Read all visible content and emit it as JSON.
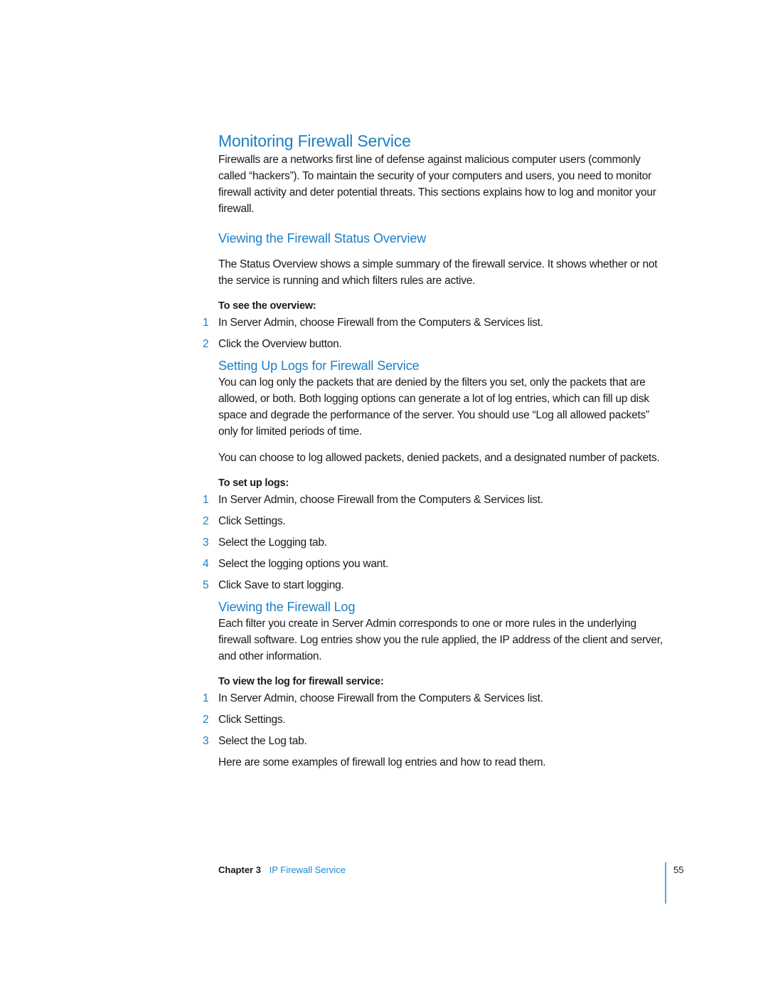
{
  "section": {
    "title": "Monitoring Firewall Service",
    "intro": "Firewalls are a networks first line of defense against malicious computer users (commonly called “hackers”). To maintain the security of your computers and users, you need to monitor firewall activity and deter potential threats. This sections explains how to log and monitor your firewall."
  },
  "subsections": [
    {
      "title": "Viewing the Firewall Status Overview",
      "paragraphs": [
        "The Status Overview shows a simple summary of the firewall service. It shows whether or not the service is running and which filters rules are active."
      ],
      "task_label": "To see the overview:",
      "steps": [
        {
          "num": "1",
          "text": "In Server Admin, choose Firewall from the Computers & Services list."
        },
        {
          "num": "2",
          "text": "Click the Overview button."
        }
      ]
    },
    {
      "title": "Setting Up Logs for Firewall Service",
      "paragraphs": [
        "You can log only the packets that are denied by the filters you set, only the packets that are allowed, or both. Both logging options can generate a lot of log entries, which can fill up disk space and degrade the performance of the server. You should use “Log all allowed packets” only for limited periods of time.",
        "You can choose to log allowed packets, denied packets, and a designated number of packets."
      ],
      "task_label": "To set up logs:",
      "steps": [
        {
          "num": "1",
          "text": "In Server Admin, choose Firewall from the Computers & Services list."
        },
        {
          "num": "2",
          "text": "Click Settings."
        },
        {
          "num": "3",
          "text": "Select the Logging tab."
        },
        {
          "num": "4",
          "text": "Select the logging options you want."
        },
        {
          "num": "5",
          "text": "Click Save to start logging."
        }
      ]
    },
    {
      "title": "Viewing the Firewall Log",
      "paragraphs": [
        "Each filter you create in Server Admin corresponds to one or more rules in the underlying firewall software. Log entries show you the rule applied, the IP address of the client and server, and other information."
      ],
      "task_label": "To view the log for firewall service:",
      "steps": [
        {
          "num": "1",
          "text": "In Server Admin, choose Firewall from the Computers & Services list."
        },
        {
          "num": "2",
          "text": "Click Settings."
        },
        {
          "num": "3",
          "text": "Select the Log tab."
        }
      ],
      "closing": "Here are some examples of firewall log entries and how to read them."
    }
  ],
  "footer": {
    "chapter": "Chapter 3",
    "chapter_title": "IP Firewall Service",
    "page_number": "55"
  },
  "colors": {
    "heading": "#1a7fc4",
    "step_number": "#1a7fc4",
    "footer_link": "#1a8ad0",
    "footer_rule": "#5aa8dd",
    "body_text": "#1a1a1a"
  }
}
